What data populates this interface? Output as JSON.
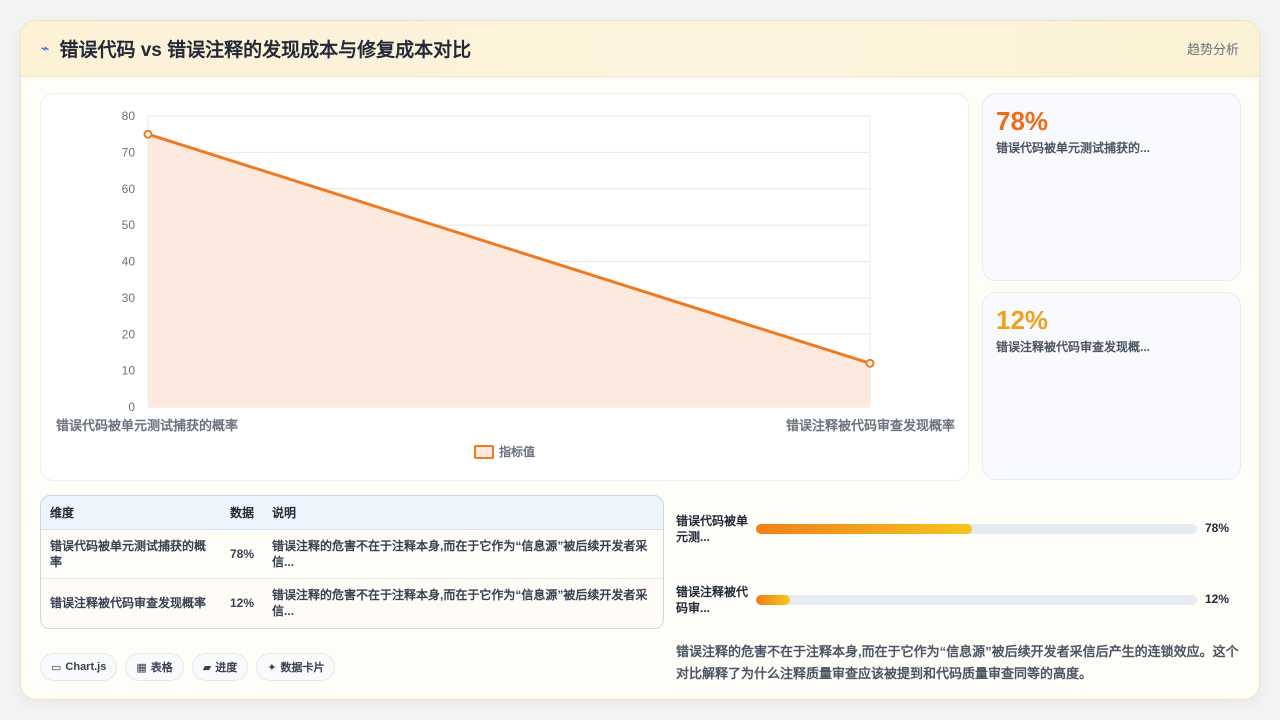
{
  "header": {
    "logo": "⌁",
    "title": "错误代码 vs 错误注释的发现成本与修复成本对比",
    "trend_link": "趋势分析"
  },
  "chart_data": {
    "type": "area",
    "categories": [
      "错误代码被单元测试捕获的概率",
      "错误注释被代码审查发现概率"
    ],
    "series": [
      {
        "name": "指标值",
        "values": [
          75,
          12
        ]
      }
    ],
    "ylim": [
      0,
      80
    ],
    "yticks": [
      0,
      10,
      20,
      30,
      40,
      50,
      60,
      70,
      80
    ],
    "grid": true,
    "legend_position": "bottom",
    "colors": {
      "line": "#ee7a22",
      "fill": "#fde9dd"
    }
  },
  "stats": [
    {
      "value": "78%",
      "label": "错误代码被单元测试捕获的...",
      "color": "#ee6d1a"
    },
    {
      "value": "12%",
      "label": "错误注释被代码审查发现概...",
      "color": "#eea11a"
    }
  ],
  "table": {
    "headers": [
      "维度",
      "数据",
      "说明"
    ],
    "rows": [
      {
        "dim": "错误代码被单元测试捕获的概率",
        "data": "78%",
        "desc": "错误注释的危害不在于注释本身,而在于它作为“信息源”被后续开发者采信..."
      },
      {
        "dim": "错误注释被代码审查发现概率",
        "data": "12%",
        "desc": "错误注释的危害不在于注释本身,而在于它作为“信息源”被后续开发者采信..."
      }
    ]
  },
  "bars": [
    {
      "label": "错误代码被单元测...",
      "value": "78%",
      "fraction": 0.49
    },
    {
      "label": "错误注释被代码审...",
      "value": "12%",
      "fraction": 0.078
    }
  ],
  "pills": [
    {
      "icon": "▭",
      "label": "Chart.js"
    },
    {
      "icon": "▦",
      "label": "表格"
    },
    {
      "icon": "▰",
      "label": "进度"
    },
    {
      "icon": "✦",
      "label": "数据卡片"
    }
  ],
  "summary": "错误注释的危害不在于注释本身,而在于它作为“信息源”被后续开发者采信后产生的连锁效应。这个对比解释了为什么注释质量审查应该被提到和代码质量审查同等的高度。"
}
